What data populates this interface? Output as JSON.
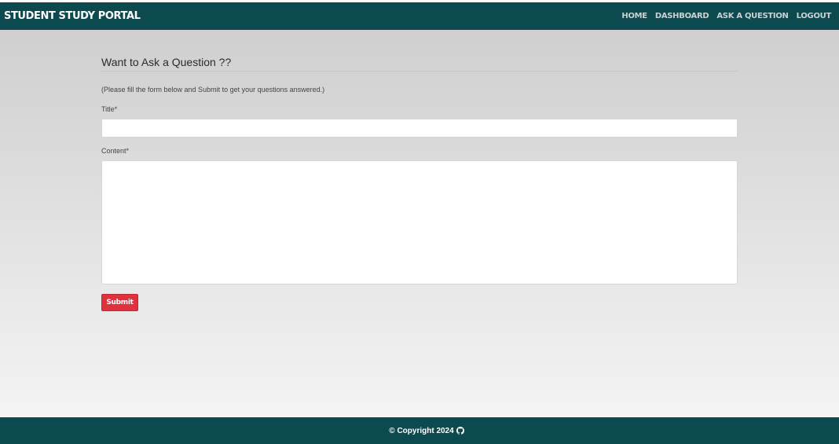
{
  "navbar": {
    "brand": "STUDENT STUDY PORTAL",
    "links": [
      "HOME",
      "DASHBOARD",
      "ASK A QUESTION",
      "LOGOUT"
    ]
  },
  "form": {
    "heading": "Want to Ask a Question ??",
    "instructions": "(Please fill the form below and Submit to get your questions answered.)",
    "title_label": "Title*",
    "title_value": "",
    "content_label": "Content*",
    "content_value": "",
    "submit_label": "Submit"
  },
  "footer": {
    "copyright": "© Copyright 2024",
    "icon": "github-icon"
  },
  "colors": {
    "nav_bg": "#0d4a50",
    "submit_bg": "#e0313f"
  }
}
